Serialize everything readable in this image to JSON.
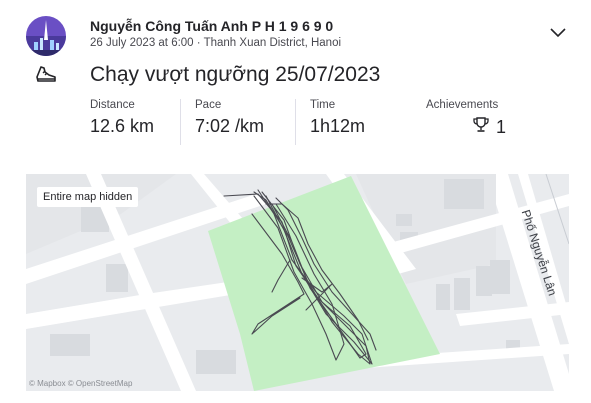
{
  "athlete": {
    "name": "Nguyễn Công Tuấn Anh P H 1 9 6 9 0",
    "meta": "26 July 2023 at 6:00 · Thanh Xuan District, Hanoi"
  },
  "activity": {
    "type_icon": "running-shoe-icon",
    "title": "Chạy vượt ngưỡng 25/07/2023"
  },
  "stats": [
    {
      "label": "Distance",
      "value": "12.6 km"
    },
    {
      "label": "Pace",
      "value": "7:02 /km"
    },
    {
      "label": "Time",
      "value": "1h12m"
    }
  ],
  "achievements": {
    "label": "Achievements",
    "icon": "trophy-icon",
    "count": "1"
  },
  "map": {
    "badge": "Entire map hidden",
    "street": "Phố Nguyễn Lân",
    "attribution": "© Mapbox © OpenStreetMap"
  },
  "colors": {
    "park": "#c4efc4",
    "road": "#ffffff",
    "block": "#e4e6e9",
    "route": "#4a4a52"
  }
}
